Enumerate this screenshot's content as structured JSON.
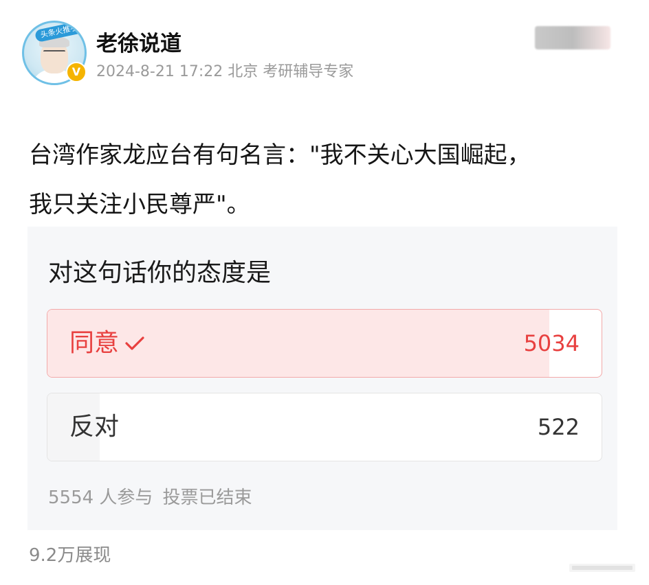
{
  "header": {
    "avatar_badge": "头条火推手",
    "author": "老徐说道",
    "timestamp": "2024-8-21 17:22",
    "location": "北京",
    "role": "考研辅导专家"
  },
  "post": {
    "line1": "台湾作家龙应台有句名言：\"我不关心大国崛起，",
    "line2": "我只关注小民尊严\"。"
  },
  "poll": {
    "question": "对这句话你的态度是",
    "options": [
      {
        "label": "同意",
        "count": "5034",
        "share": 0.906,
        "selected": true
      },
      {
        "label": "反对",
        "count": "522",
        "share": 0.094,
        "selected": false
      }
    ],
    "participants": "5554 人参与",
    "status": "投票已结束"
  },
  "footer": {
    "views": "9.2万展现"
  },
  "colors": {
    "accent": "#e8403f",
    "selected_fill": "#fde7e7",
    "muted_text": "#9a9a9a",
    "poll_bg": "#f6f7f9"
  },
  "icons": {
    "verify": "verified-v-icon",
    "check": "check-icon"
  }
}
